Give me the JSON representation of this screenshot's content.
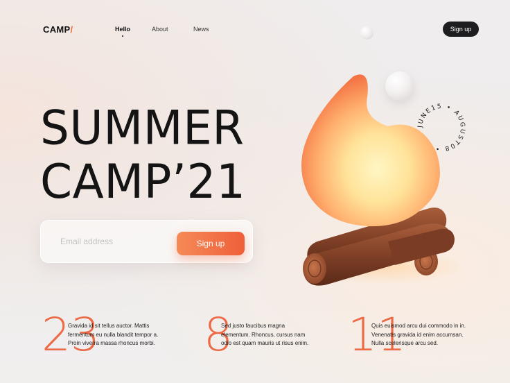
{
  "header": {
    "logo_text": "CAMP",
    "logo_slash": "/",
    "nav": [
      {
        "label": "Hello",
        "active": true
      },
      {
        "label": "About",
        "active": false
      },
      {
        "label": "News",
        "active": false
      }
    ],
    "signup_label": "Sign up"
  },
  "hero": {
    "title_line1": "SUMMER",
    "title_line2": "CAMP’21",
    "email_placeholder": "Email address",
    "submit_label": "Sign up",
    "date_ring_text": "JUNE15 • AUGUST08 •"
  },
  "stats": [
    {
      "number": "23",
      "text": "Gravida id sit tellus auctor. Mattis fermentum eu nulla blandit tempor a. Proin viverra massa rhoncus morbi."
    },
    {
      "number": "8",
      "text": "Sed justo faucibus magna elementum. Rhoncus, cursus nam odio est quam mauris ut risus enim."
    },
    {
      "number": "11",
      "text": "Quis euismod arcu dui commodo in in. Venenatis gravida id enim accumsan. Nulla scelerisque arcu sed."
    }
  ],
  "colors": {
    "accent": "#ef6a42",
    "dark": "#1d1d1f"
  }
}
